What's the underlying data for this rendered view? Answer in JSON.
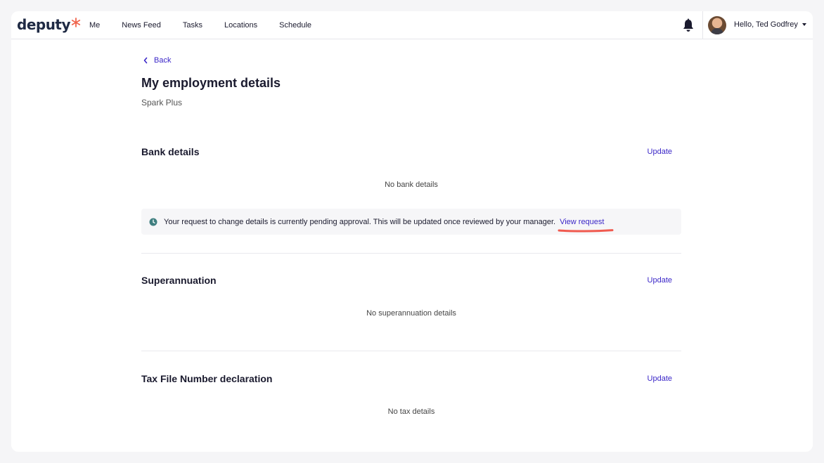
{
  "brand": {
    "logo_text": "deputy",
    "accent": "#f0644c"
  },
  "nav": {
    "items": [
      {
        "label": "Me"
      },
      {
        "label": "News Feed"
      },
      {
        "label": "Tasks"
      },
      {
        "label": "Locations"
      },
      {
        "label": "Schedule"
      }
    ]
  },
  "header": {
    "greeting": "Hello, Ted Godfrey",
    "notification_icon": "bell-icon"
  },
  "page": {
    "back_label": "Back",
    "title": "My employment details",
    "subtitle": "Spark Plus"
  },
  "sections": {
    "bank": {
      "title": "Bank details",
      "update_label": "Update",
      "empty_text": "No bank details",
      "notice_text": "Your request to change details is currently pending approval. This will be updated once reviewed by your manager.",
      "notice_link": "View request"
    },
    "super": {
      "title": "Superannuation",
      "update_label": "Update",
      "empty_text": "No superannuation details"
    },
    "tax": {
      "title": "Tax File Number declaration",
      "update_label": "Update",
      "empty_text": "No tax details"
    }
  },
  "colors": {
    "link": "#3b27c8",
    "highlight": "#f05a4f",
    "notice_icon": "#3f7f80"
  }
}
